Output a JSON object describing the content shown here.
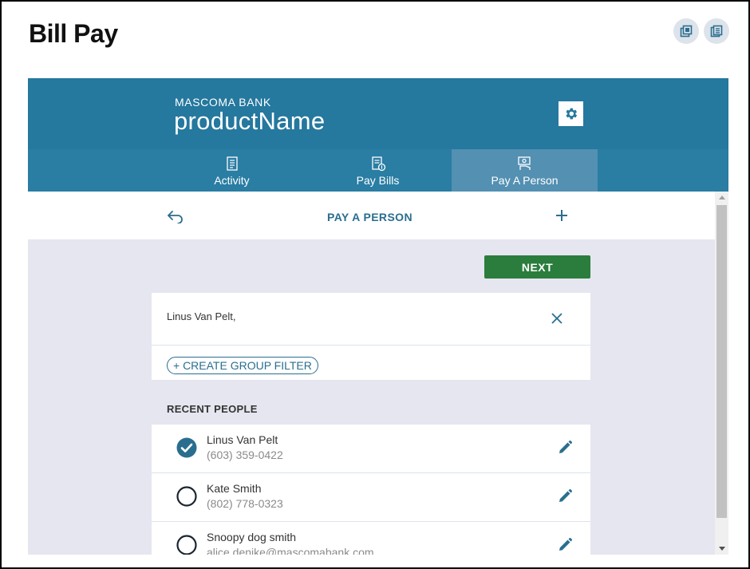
{
  "page": {
    "title": "Bill Pay"
  },
  "app": {
    "bank_name": "MASCOMA BANK",
    "product_name": "productName",
    "tabs": [
      {
        "label": "Activity",
        "icon": "document-list-icon",
        "active": false
      },
      {
        "label": "Pay Bills",
        "icon": "bill-pay-icon",
        "active": false
      },
      {
        "label": "Pay A Person",
        "icon": "pay-person-icon",
        "active": true
      }
    ],
    "subbar_title": "PAY A PERSON",
    "next_label": "NEXT",
    "selected_recipients": "Linus Van Pelt,",
    "create_group_filter_label": "+ CREATE GROUP FILTER",
    "recent_heading": "RECENT PEOPLE",
    "people": [
      {
        "name": "Linus Van Pelt",
        "detail": "(603) 359-0422",
        "selected": true
      },
      {
        "name": "Kate Smith",
        "detail": "(802) 778-0323",
        "selected": false
      },
      {
        "name": "Snoopy dog smith",
        "detail": "alice.denike@mascomabank.com",
        "selected": false
      }
    ]
  },
  "colors": {
    "header": "#25789e",
    "tab_bar": "#2a7da3",
    "tab_active": "#5390b2",
    "accent": "#2a6e8f",
    "next_button": "#2a7d3c",
    "content_bg": "#e5e6ef"
  }
}
